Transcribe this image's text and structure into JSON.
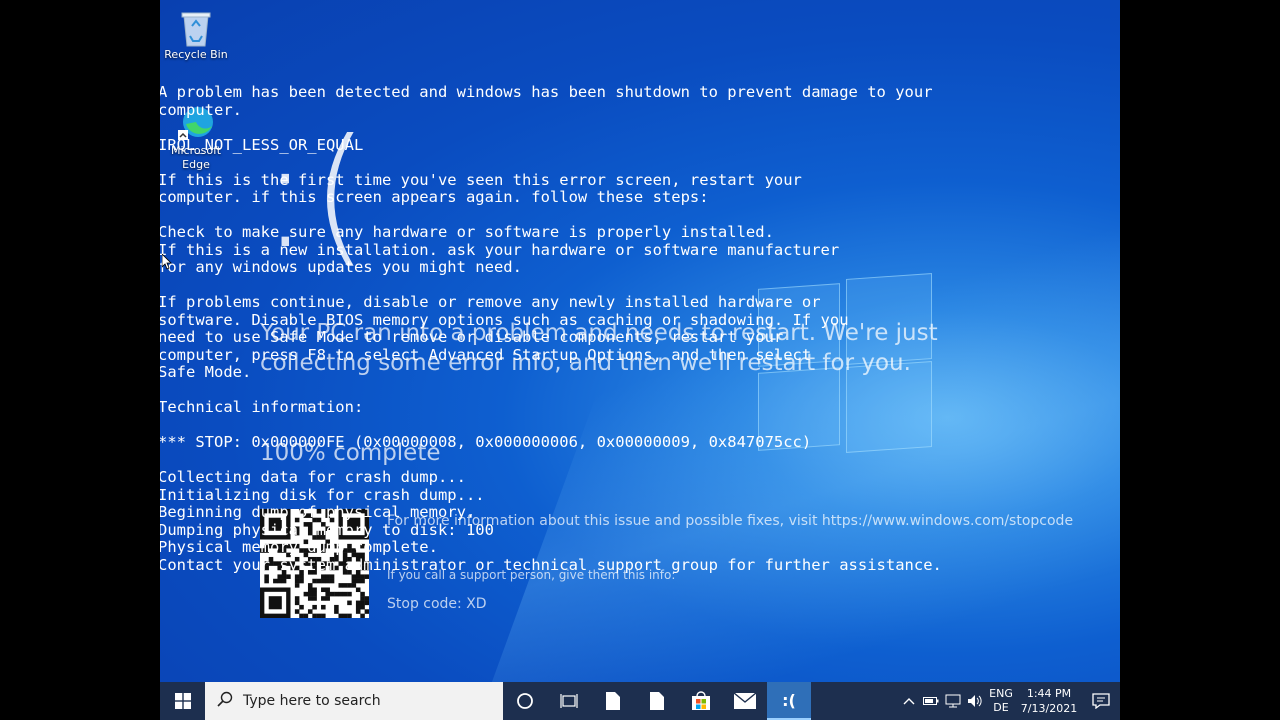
{
  "desktop": {
    "icons": [
      {
        "label": "Recycle Bin",
        "icon": "recycle-bin-icon"
      },
      {
        "label": "Microsoft Edge",
        "icon": "edge-icon"
      }
    ]
  },
  "bsod": {
    "lines": [
      "A problem has been detected and windows has been shutdown to prevent damage to your",
      "computer.",
      "",
      "IRQL_NOT_LESS_OR_EQUAL",
      "",
      "If this is the first time you've seen this error screen, restart your",
      "computer. if this screen appears again. follow these steps:",
      "",
      "Check to make sure any hardware or software is properly installed.",
      "If this is a new installation. ask your hardware or software manufacturer",
      "for any windows updates you might need.",
      "",
      "If problems continue, disable or remove any newly installed hardware or",
      "software. Disable BIOS memory options such as caching or shadowing. If you",
      "need to use Safe Mode to remove or disable components, restart your",
      "computer, press F8 to select Advanced Startup Options, and then select",
      "Safe Mode.",
      "",
      "Technical information:",
      "",
      "*** STOP: 0x000000FE (0x00000008, 0x000000006, 0x00000009, 0x847075cc)",
      "",
      "Collecting data for crash dump...",
      "Initializing disk for crash dump...",
      "Beginning dump of physical memory.",
      "Dumping physical memory to disk: 100",
      "Physical memory dump complete.",
      "Contact your system administrator or technical support group for further assistance."
    ]
  },
  "overlay": {
    "frown": ":(",
    "message": "Your PC ran into a problem and needs to restart. We're just collecting some error info, and then we'll restart for you.",
    "progress": "100% complete",
    "more_info": "For more information about this issue and possible fixes, visit https://www.windows.com/stopcode",
    "support": "If you call a support person, give them this info:",
    "stop_code": "Stop code: XD"
  },
  "taskbar": {
    "search_placeholder": "Type here to search",
    "active_app_label": ":(",
    "language": {
      "line1": "ENG",
      "line2": "DE"
    },
    "time": "1:44 PM",
    "date": "7/13/2021"
  },
  "colors": {
    "taskbar": "#1d2f4f",
    "desktop_blue": "#0a4cc0",
    "active_task": "#2f6fb8"
  }
}
